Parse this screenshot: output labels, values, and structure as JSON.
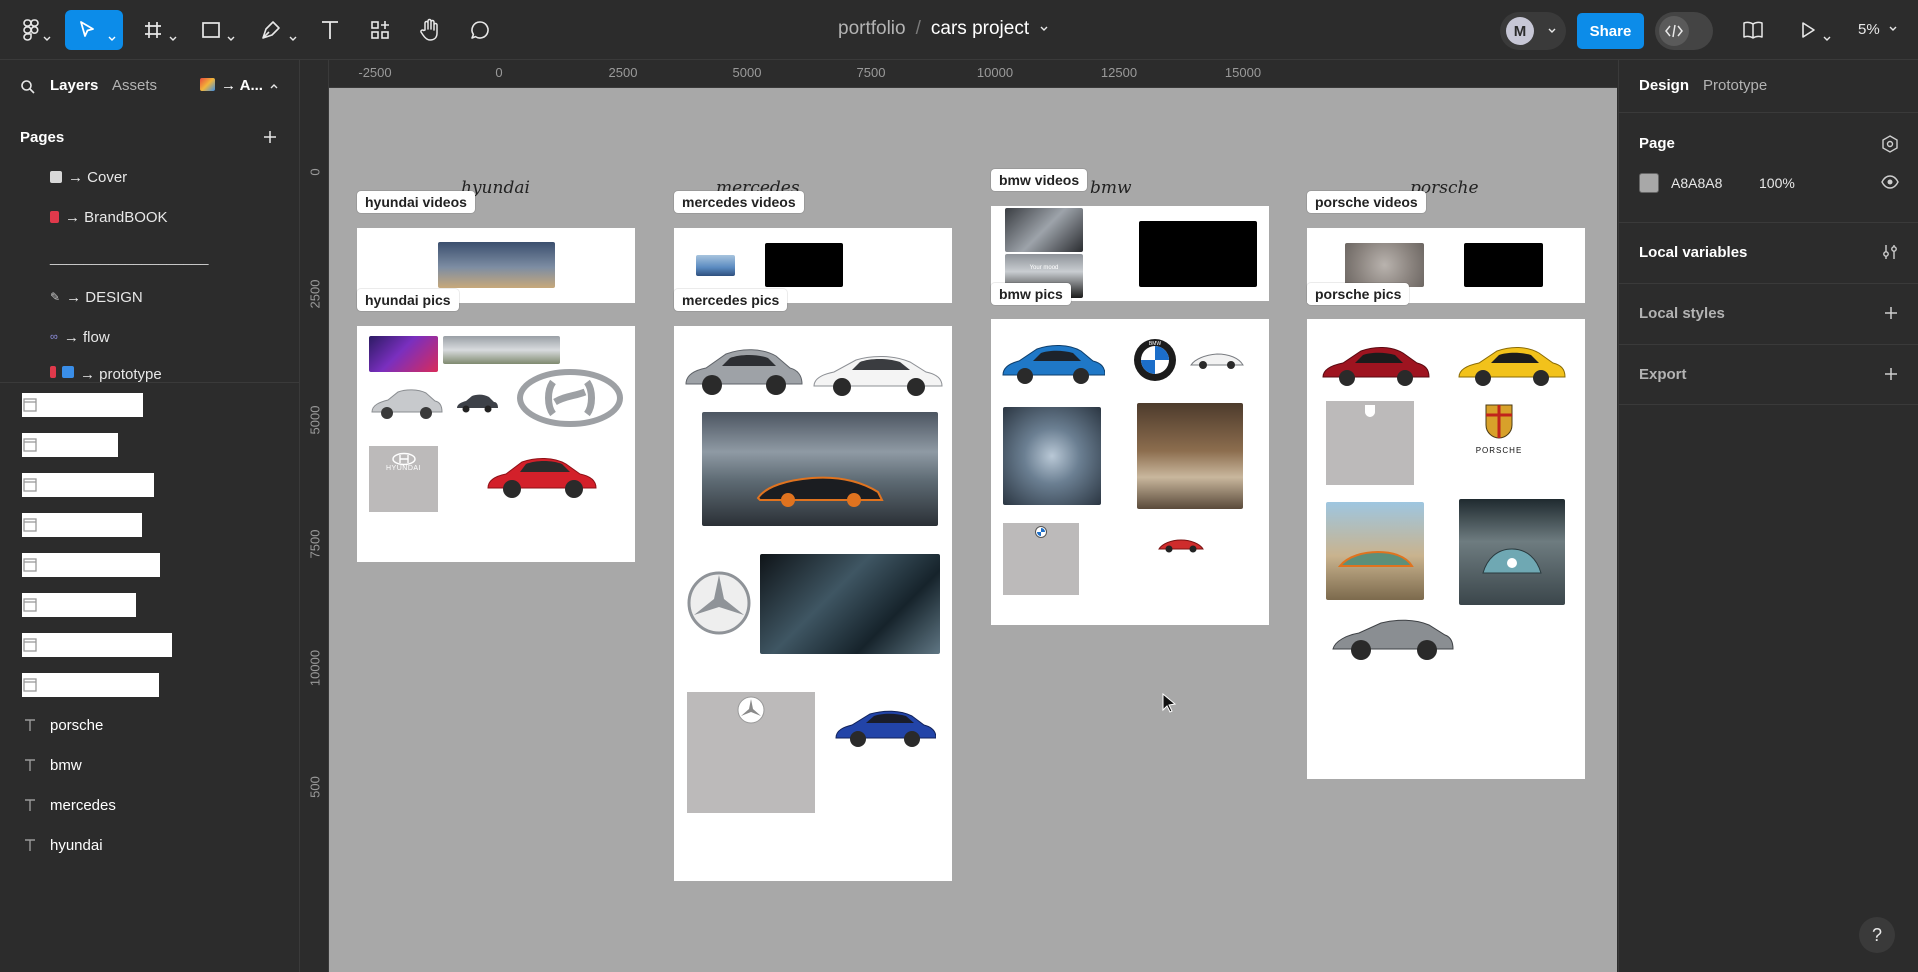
{
  "toolbar": {
    "breadcrumb_project": "portfolio",
    "breadcrumb_sep": "/",
    "breadcrumb_file": "cars project",
    "avatar_initial": "M",
    "share_label": "Share",
    "zoom_label": "5%"
  },
  "left_panel": {
    "tab_layers": "Layers",
    "tab_assets": "Assets",
    "library_label": "→ A...",
    "pages_title": "Pages",
    "pages": [
      {
        "label": "→ Cover"
      },
      {
        "label": "→ BrandBOOK"
      },
      {
        "label": "___________________"
      },
      {
        "label": "→ DESIGN"
      },
      {
        "label": "→ flow"
      },
      {
        "label": "→ prototype"
      }
    ],
    "layers": [
      {
        "label": "porsche pics",
        "kind": "frame"
      },
      {
        "label": "bmw pics",
        "kind": "frame"
      },
      {
        "label": "mercedes pics",
        "kind": "frame"
      },
      {
        "label": "hyundai pics",
        "kind": "frame"
      },
      {
        "label": "porsche videos",
        "kind": "frame"
      },
      {
        "label": "bmw videos",
        "kind": "frame"
      },
      {
        "label": "mercedes videos",
        "kind": "frame"
      },
      {
        "label": "hyundai videos",
        "kind": "frame"
      },
      {
        "label": "porsche",
        "kind": "text"
      },
      {
        "label": "bmw",
        "kind": "text"
      },
      {
        "label": "mercedes",
        "kind": "text"
      },
      {
        "label": "hyundai",
        "kind": "text"
      }
    ]
  },
  "canvas": {
    "ruler_top": [
      "-2500",
      "0",
      "2500",
      "5000",
      "7500",
      "10000",
      "12500",
      "15000"
    ],
    "ruler_left": [
      "0",
      "2500",
      "5000",
      "7500",
      "10000",
      "500"
    ],
    "titles": {
      "hyundai": "hyundai",
      "mercedes": "mercedes",
      "bmw": "bmw",
      "porsche": "porsche"
    },
    "labels": {
      "hyundai_videos": "hyundai videos",
      "hyundai_pics": "hyundai pics",
      "mercedes_videos": "mercedes videos",
      "mercedes_pics": "mercedes pics",
      "bmw_videos": "bmw videos",
      "bmw_pics": "bmw pics",
      "porsche_videos": "porsche videos",
      "porsche_pics": "porsche pics"
    },
    "brand_text": {
      "hyundai_logo": "HYUNDAI",
      "porsche_logo": "PORSCHE",
      "bmw_logo": "BMW",
      "video_caption": "Your mood"
    }
  },
  "right_panel": {
    "tab_design": "Design",
    "tab_prototype": "Prototype",
    "page_title": "Page",
    "page_color": "A8A8A8",
    "page_opacity": "100%",
    "local_variables": "Local variables",
    "local_styles": "Local styles",
    "export": "Export"
  },
  "help_label": "?"
}
